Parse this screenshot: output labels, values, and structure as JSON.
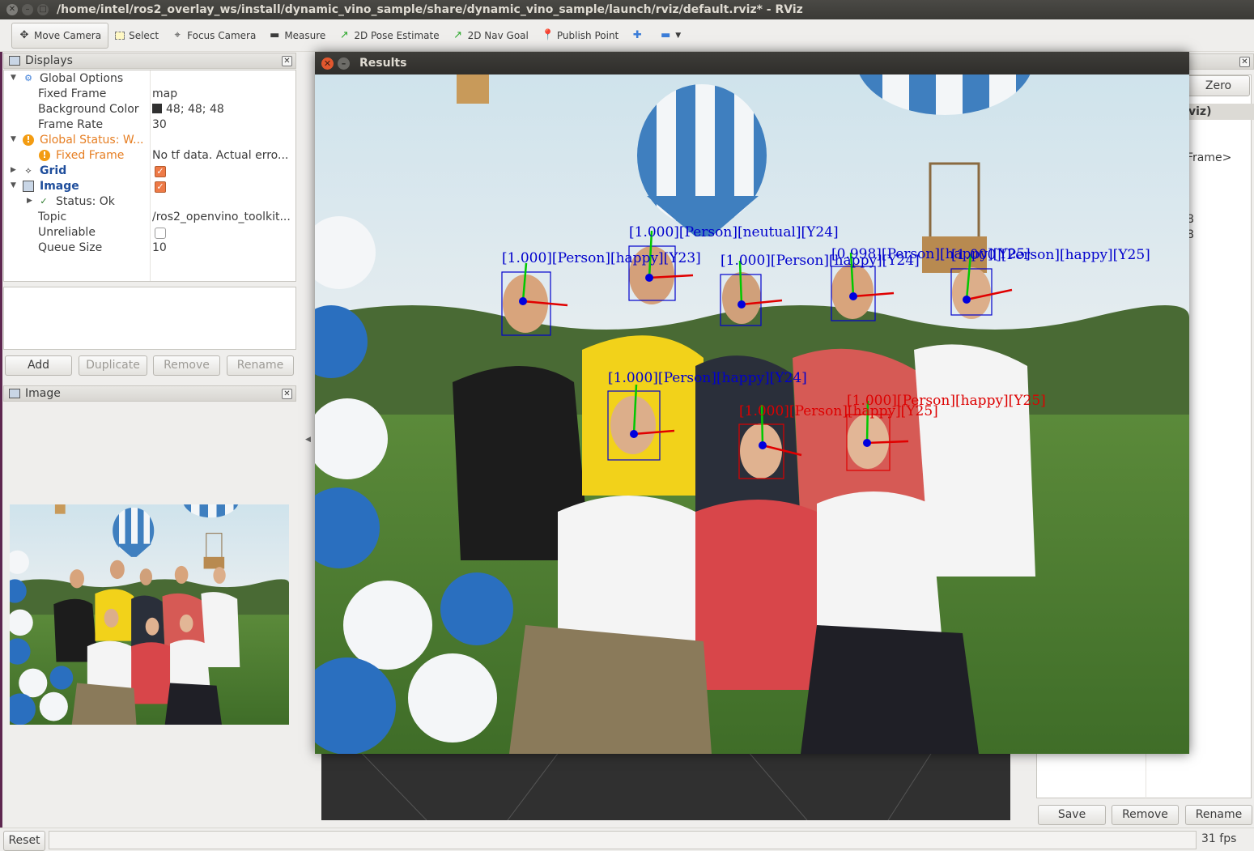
{
  "window": {
    "title": "/home/intel/ros2_overlay_ws/install/dynamic_vino_sample/share/dynamic_vino_sample/launch/rviz/default.rviz* - RViz"
  },
  "toolbar": {
    "tools": [
      {
        "label": "Move Camera",
        "icon": "move-camera-icon"
      },
      {
        "label": "Select",
        "icon": "select-icon"
      },
      {
        "label": "Focus Camera",
        "icon": "focus-camera-icon"
      },
      {
        "label": "Measure",
        "icon": "measure-icon"
      },
      {
        "label": "2D Pose Estimate",
        "icon": "pose-estimate-icon"
      },
      {
        "label": "2D Nav Goal",
        "icon": "nav-goal-icon"
      },
      {
        "label": "Publish Point",
        "icon": "publish-point-icon"
      }
    ]
  },
  "displays": {
    "title": "Displays",
    "global_options": "Global Options",
    "fixed_frame_label": "Fixed Frame",
    "fixed_frame_value": "map",
    "background_color_label": "Background Color",
    "background_color_value": "48; 48; 48",
    "frame_rate_label": "Frame Rate",
    "frame_rate_value": "30",
    "global_status_label": "Global Status: W...",
    "fixed_frame_status_label": "Fixed Frame",
    "fixed_frame_status_value": "No tf data.  Actual erro...",
    "grid_label": "Grid",
    "image_label": "Image",
    "image_status_label": "Status: Ok",
    "topic_label": "Topic",
    "topic_value": "/ros2_openvino_toolkit...",
    "unreliable_label": "Unreliable",
    "queue_size_label": "Queue Size",
    "queue_size_value": "10",
    "buttons": {
      "add": "Add",
      "duplicate": "Duplicate",
      "remove": "Remove",
      "rename": "Rename"
    }
  },
  "image_panel": {
    "title": "Image"
  },
  "results": {
    "title": "Results",
    "faces": [
      {
        "label": "[1.000][Person][happy][Y23]",
        "color": "blue"
      },
      {
        "label": "[1.000][Person][neutual][Y24]",
        "color": "blue"
      },
      {
        "label": "[1.000][Person][happy][Y24]",
        "color": "blue"
      },
      {
        "label": "[0.998][Person][happy][Y25]",
        "color": "blue"
      },
      {
        "label": "[1.000][Person][happy][Y25]",
        "color": "blue"
      },
      {
        "label": "[1.000][Person][happy][Y24]",
        "color": "blue"
      },
      {
        "label": "[1.000][Person][happy][Y25]",
        "color": "red"
      },
      {
        "label": "[1.000][Person][happy][Y25]",
        "color": "red"
      }
    ]
  },
  "views_panel": {
    "zero_button": "Zero",
    "header_fragment": "viz)",
    "frame_fragment": "Frame>",
    "value_fragment_1": "8",
    "value_fragment_2": "8",
    "buttons": {
      "save": "Save",
      "remove": "Remove",
      "rename": "Rename"
    }
  },
  "statusbar": {
    "reset": "Reset",
    "fps": "31 fps"
  },
  "colors": {
    "accent_orange": "#ee7a47",
    "background": "#303030",
    "box_blue": "#0000cc",
    "box_red": "#dd0000"
  }
}
